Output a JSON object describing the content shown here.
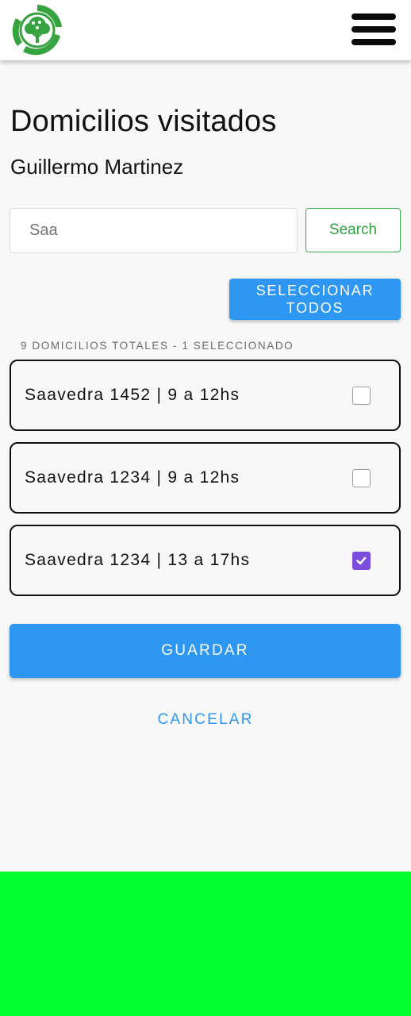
{
  "header": {
    "logo_icon": "recycling-tree-logo",
    "menu_icon": "hamburger-menu-icon"
  },
  "page": {
    "title": "Domicilios visitados",
    "person_name": "Guillermo Martinez"
  },
  "search": {
    "value": "",
    "placeholder": "Saa",
    "button_label": "Search"
  },
  "select_all_label": "SELECCIONAR TODOS",
  "summary": "9 DOMICILIOS TOTALES - 1 SELECCIONADO",
  "addresses": [
    {
      "label": "Saavedra 1452 | 9 a 12hs",
      "checked": false
    },
    {
      "label": "Saavedra 1234 | 9 a 12hs",
      "checked": false
    },
    {
      "label": "Saavedra 1234 | 13 a 17hs",
      "checked": true
    }
  ],
  "actions": {
    "save_label": "GUARDAR",
    "cancel_label": "CANCELAR"
  },
  "colors": {
    "primary": "#2d97f3",
    "search_border": "#3dab4a",
    "checkbox_checked": "#7c4ddd",
    "bottom_bar": "#00ff2f",
    "logo_green": "#35a33f"
  }
}
